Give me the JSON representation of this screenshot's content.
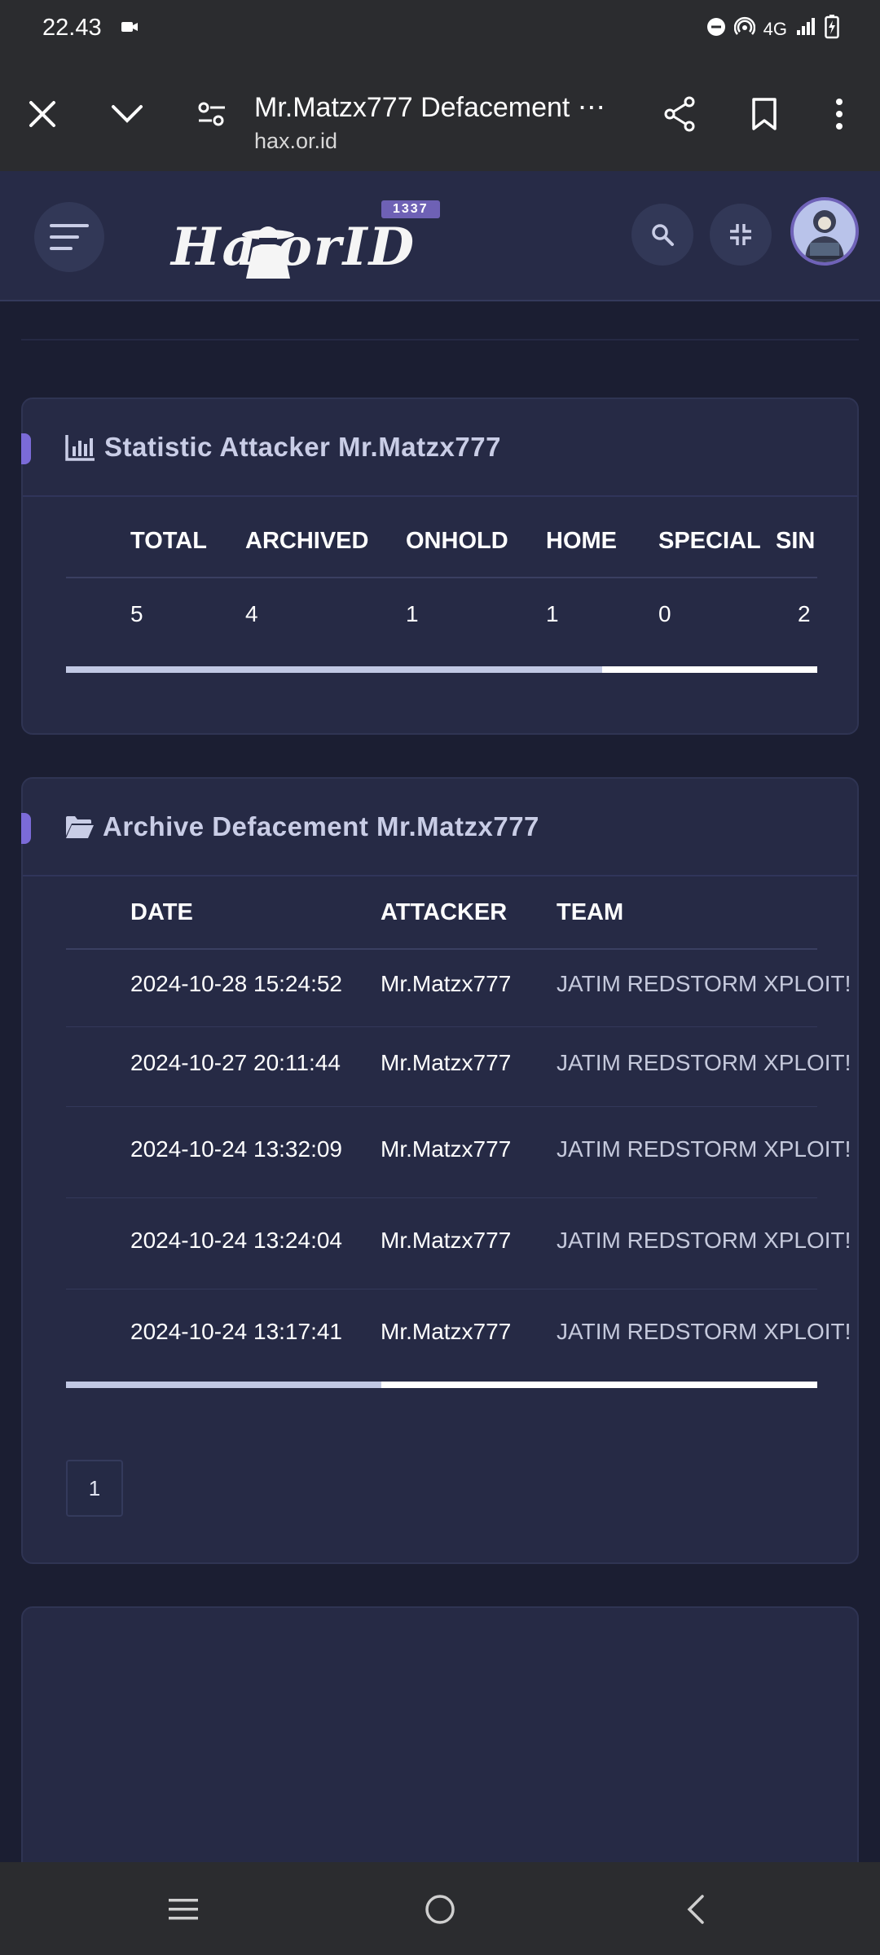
{
  "status_bar": {
    "time": "22.43",
    "network": "4G"
  },
  "browser": {
    "title": "Mr.Matzx777 Defacement ⋯",
    "url": "hax.or.id"
  },
  "header": {
    "logo_text": "Ha  orID",
    "logo_badge": "1337"
  },
  "statistic": {
    "title": "Statistic Attacker Mr.Matzx777",
    "columns": [
      "TOTAL",
      "ARCHIVED",
      "ONHOLD",
      "HOME",
      "SPECIAL",
      "SIN"
    ],
    "values": [
      "5",
      "4",
      "1",
      "1",
      "0",
      "2"
    ],
    "scroll_fraction": 0.714
  },
  "archive": {
    "title": "Archive Defacement Mr.Matzx777",
    "columns": [
      "DATE",
      "ATTACKER",
      "TEAM"
    ],
    "rows": [
      {
        "date": "2024-10-28 15:24:52",
        "attacker": "Mr.Matzx777",
        "team": "JATIM REDSTORM XPLOIT!"
      },
      {
        "date": "2024-10-27 20:11:44",
        "attacker": "Mr.Matzx777",
        "team": "JATIM REDSTORM XPLOIT!"
      },
      {
        "date": "2024-10-24 13:32:09",
        "attacker": "Mr.Matzx777",
        "team": "JATIM REDSTORM XPLOIT!"
      },
      {
        "date": "2024-10-24 13:24:04",
        "attacker": "Mr.Matzx777",
        "team": "JATIM REDSTORM XPLOIT!"
      },
      {
        "date": "2024-10-24 13:17:41",
        "attacker": "Mr.Matzx777",
        "team": "JATIM REDSTORM XPLOIT!"
      }
    ],
    "scroll_fraction": 0.42,
    "pagination": [
      "1"
    ]
  },
  "colors": {
    "background": "#1b1e32",
    "card": "#262a45",
    "accent": "#7b6bd8"
  }
}
